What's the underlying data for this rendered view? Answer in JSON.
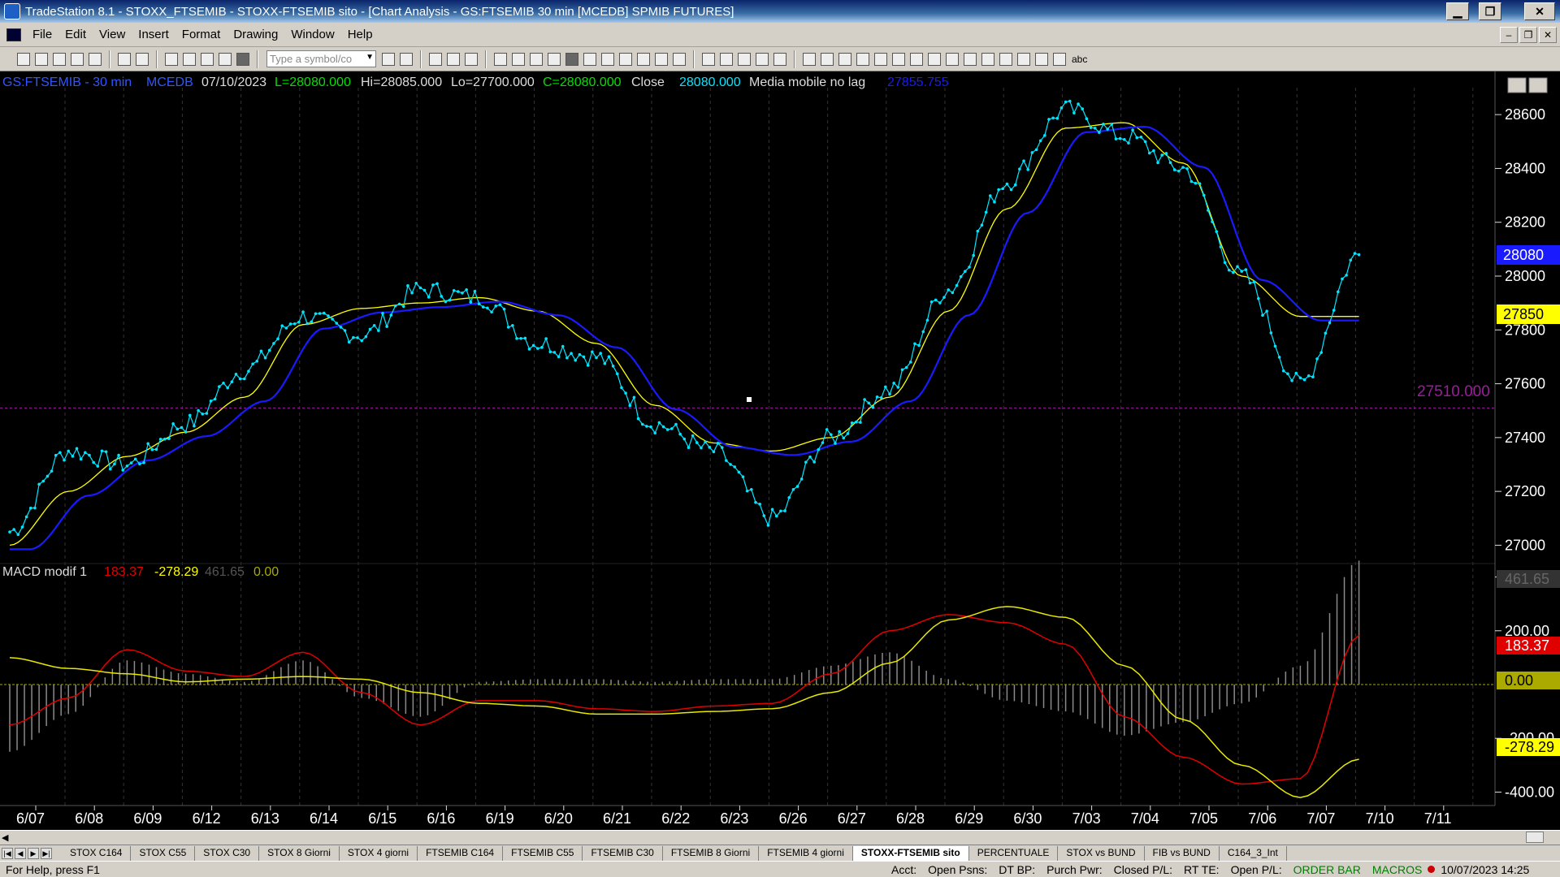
{
  "window": {
    "title": "TradeStation 8.1 - STOXX_FTSEMIB - STOXX-FTSEMIB sito - [Chart Analysis - GS:FTSEMIB  30 min  [MCEDB] SPMIB FUTURES]",
    "min": "▁",
    "restore": "❐",
    "close": "✕"
  },
  "menu": [
    "File",
    "Edit",
    "View",
    "Insert",
    "Format",
    "Drawing",
    "Window",
    "Help"
  ],
  "mdi_controls": {
    "min": "–",
    "restore": "❐",
    "close": "✕"
  },
  "toolbar": {
    "symbol_placeholder": "Type a symbol/co",
    "text_tool": "abc"
  },
  "header": {
    "symbol": "GS:FTSEMIB - 30 min",
    "exchange": "MCEDB",
    "date": "07/10/2023",
    "last": "L=28080.000",
    "high": "Hi=28085.000",
    "low": "Lo=27700.000",
    "close": "C=28080.000",
    "close_label": "Close",
    "close_value": "28080.000",
    "ma_label": "Media mobile no lag",
    "ma_value": "27855.755"
  },
  "colors": {
    "price": "#00e5ff",
    "ma_yellow": "#ffff00",
    "ma_blue": "#1a1aff",
    "macd_red": "#e00000",
    "signal_yellow": "#e8e800",
    "histogram": "#8a8a8a",
    "hline": "#9b1d9b"
  },
  "price_axis": {
    "ticks": [
      "28600",
      "28400",
      "28200",
      "28000",
      "27800",
      "27600",
      "27400",
      "27200",
      "27000"
    ]
  },
  "price_markers": {
    "last": "28080",
    "ma": "27850",
    "hline": "27510.000"
  },
  "macd": {
    "label": "MACD modif 1",
    "macd_value": "183.37",
    "signal_value": "-278.29",
    "hist_value": "461.65",
    "zero_value": "0.00",
    "axis_ticks": [
      "400.00",
      "200.00",
      "-200.00",
      "-400.00"
    ],
    "marker_hist": "461.65",
    "marker_macd": "183.37",
    "marker_zero": "0.00",
    "marker_signal": "-278.29"
  },
  "date_axis": [
    "6/07",
    "6/08",
    "6/09",
    "6/12",
    "6/13",
    "6/14",
    "6/15",
    "6/16",
    "6/19",
    "6/20",
    "6/21",
    "6/22",
    "6/23",
    "6/26",
    "6/27",
    "6/28",
    "6/29",
    "6/30",
    "7/03",
    "7/04",
    "7/05",
    "7/06",
    "7/07",
    "7/10",
    "7/11"
  ],
  "tabs": [
    "STOX C164",
    "STOX C55",
    "STOX  C30",
    "STOX  8 Giorni",
    "STOX 4 giorni",
    "FTSEMIB C164",
    "FTSEMIB C55",
    "FTSEMIB C30",
    "FTSEMIB  8 Giorni",
    "FTSEMIB  4 giorni",
    "STOXX-FTSEMIB sito",
    "PERCENTUALE",
    "STOX vs BUND",
    "FIB vs BUND",
    "C164_3_Int"
  ],
  "active_tab": "STOXX-FTSEMIB sito",
  "status": {
    "help": "For Help, press F1",
    "acct": "Acct:",
    "open_psns": "Open Psns:",
    "dt_bp": "DT BP:",
    "purch_pwr": "Purch Pwr:",
    "closed_pl": "Closed P/L:",
    "rt_te": "RT TE:",
    "open_pl": "Open P/L:",
    "order_bar": "ORDER BAR",
    "macros": "MACROS",
    "datetime": "10/07/2023 14:25"
  },
  "chart_data": {
    "type": "line",
    "title": "GS:FTSEMIB - 30 min",
    "xlabel": "",
    "ylabel": "",
    "ylim": [
      26950,
      28700
    ],
    "x": [
      "6/07",
      "6/08",
      "6/09",
      "6/12",
      "6/13",
      "6/14",
      "6/15",
      "6/16",
      "6/19",
      "6/20",
      "6/21",
      "6/22",
      "6/23",
      "6/26",
      "6/27",
      "6/28",
      "6/29",
      "6/30",
      "7/03",
      "7/04",
      "7/05",
      "7/06",
      "7/07",
      "7/10"
    ],
    "series": [
      {
        "name": "Close",
        "values": [
          27050,
          27350,
          27300,
          27450,
          27650,
          27850,
          27780,
          27950,
          27920,
          27750,
          27700,
          27450,
          27350,
          27100,
          27400,
          27580,
          27950,
          28350,
          28620,
          28520,
          28400,
          28000,
          27600,
          28080
        ]
      },
      {
        "name": "Media mobile no lag",
        "values": [
          27000,
          27200,
          27330,
          27420,
          27550,
          27820,
          27880,
          27900,
          27920,
          27870,
          27750,
          27520,
          27380,
          27350,
          27400,
          27550,
          27870,
          28250,
          28550,
          28570,
          28420,
          28000,
          27850,
          27850
        ]
      }
    ],
    "horizontal_line": 27510,
    "macd": {
      "ylim": [
        -450,
        450
      ],
      "macd": [
        -150,
        -50,
        130,
        50,
        30,
        120,
        -30,
        -150,
        -60,
        -60,
        -90,
        -100,
        -80,
        -70,
        40,
        200,
        260,
        230,
        150,
        -120,
        -270,
        -370,
        -350,
        183
      ],
      "signal": [
        100,
        60,
        40,
        10,
        20,
        30,
        20,
        -30,
        -70,
        -80,
        -110,
        -110,
        -100,
        -90,
        -30,
        80,
        240,
        290,
        250,
        70,
        -130,
        -300,
        -420,
        -278
      ],
      "histogram_last": 461.65
    }
  }
}
